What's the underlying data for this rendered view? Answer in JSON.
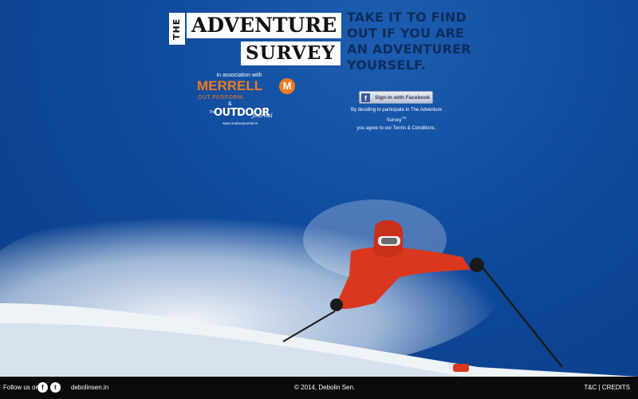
{
  "logo": {
    "the": "THE",
    "adventure": "ADVENTURE",
    "survey": "SURVEY",
    "tm": "TM"
  },
  "sponsors": {
    "association": "in association with",
    "merrell_name": "MERRELL",
    "merrell_mark": "M",
    "merrell_tagline": "OUT.PERFORM.",
    "ampersand": "&",
    "outdoor_the": "The",
    "outdoor_name": "OUTDOOR",
    "outdoor_journal": "Journal",
    "outdoor_url": "www.outdoorjournal.in"
  },
  "headline": {
    "line1": "TAKE IT TO FIND",
    "line2": "OUT IF YOU ARE",
    "line3": "AN ADVENTURER",
    "line4": "YOURSELF."
  },
  "signin": {
    "icon": "f",
    "label": "Sign-in with Facebook"
  },
  "consent": {
    "line1": "By deciding to participate in The Adventure Survey",
    "tm": "TM",
    "line2": "you agree to our Terms & Conditions."
  },
  "footer": {
    "follow": "Follow us on:",
    "facebook_icon": "f",
    "twitter_icon": "t",
    "site": "debolinsen.in",
    "copyright": "© 2014, Debolin Sen.",
    "tc": "T&C",
    "separator": "|",
    "credits": "CREDITS"
  },
  "colors": {
    "sky": "#0f4a9c",
    "headline": "#0b2d5d",
    "merrell": "#f27a1f",
    "footer": "#0b0b0b",
    "facebook": "#3b5998"
  }
}
